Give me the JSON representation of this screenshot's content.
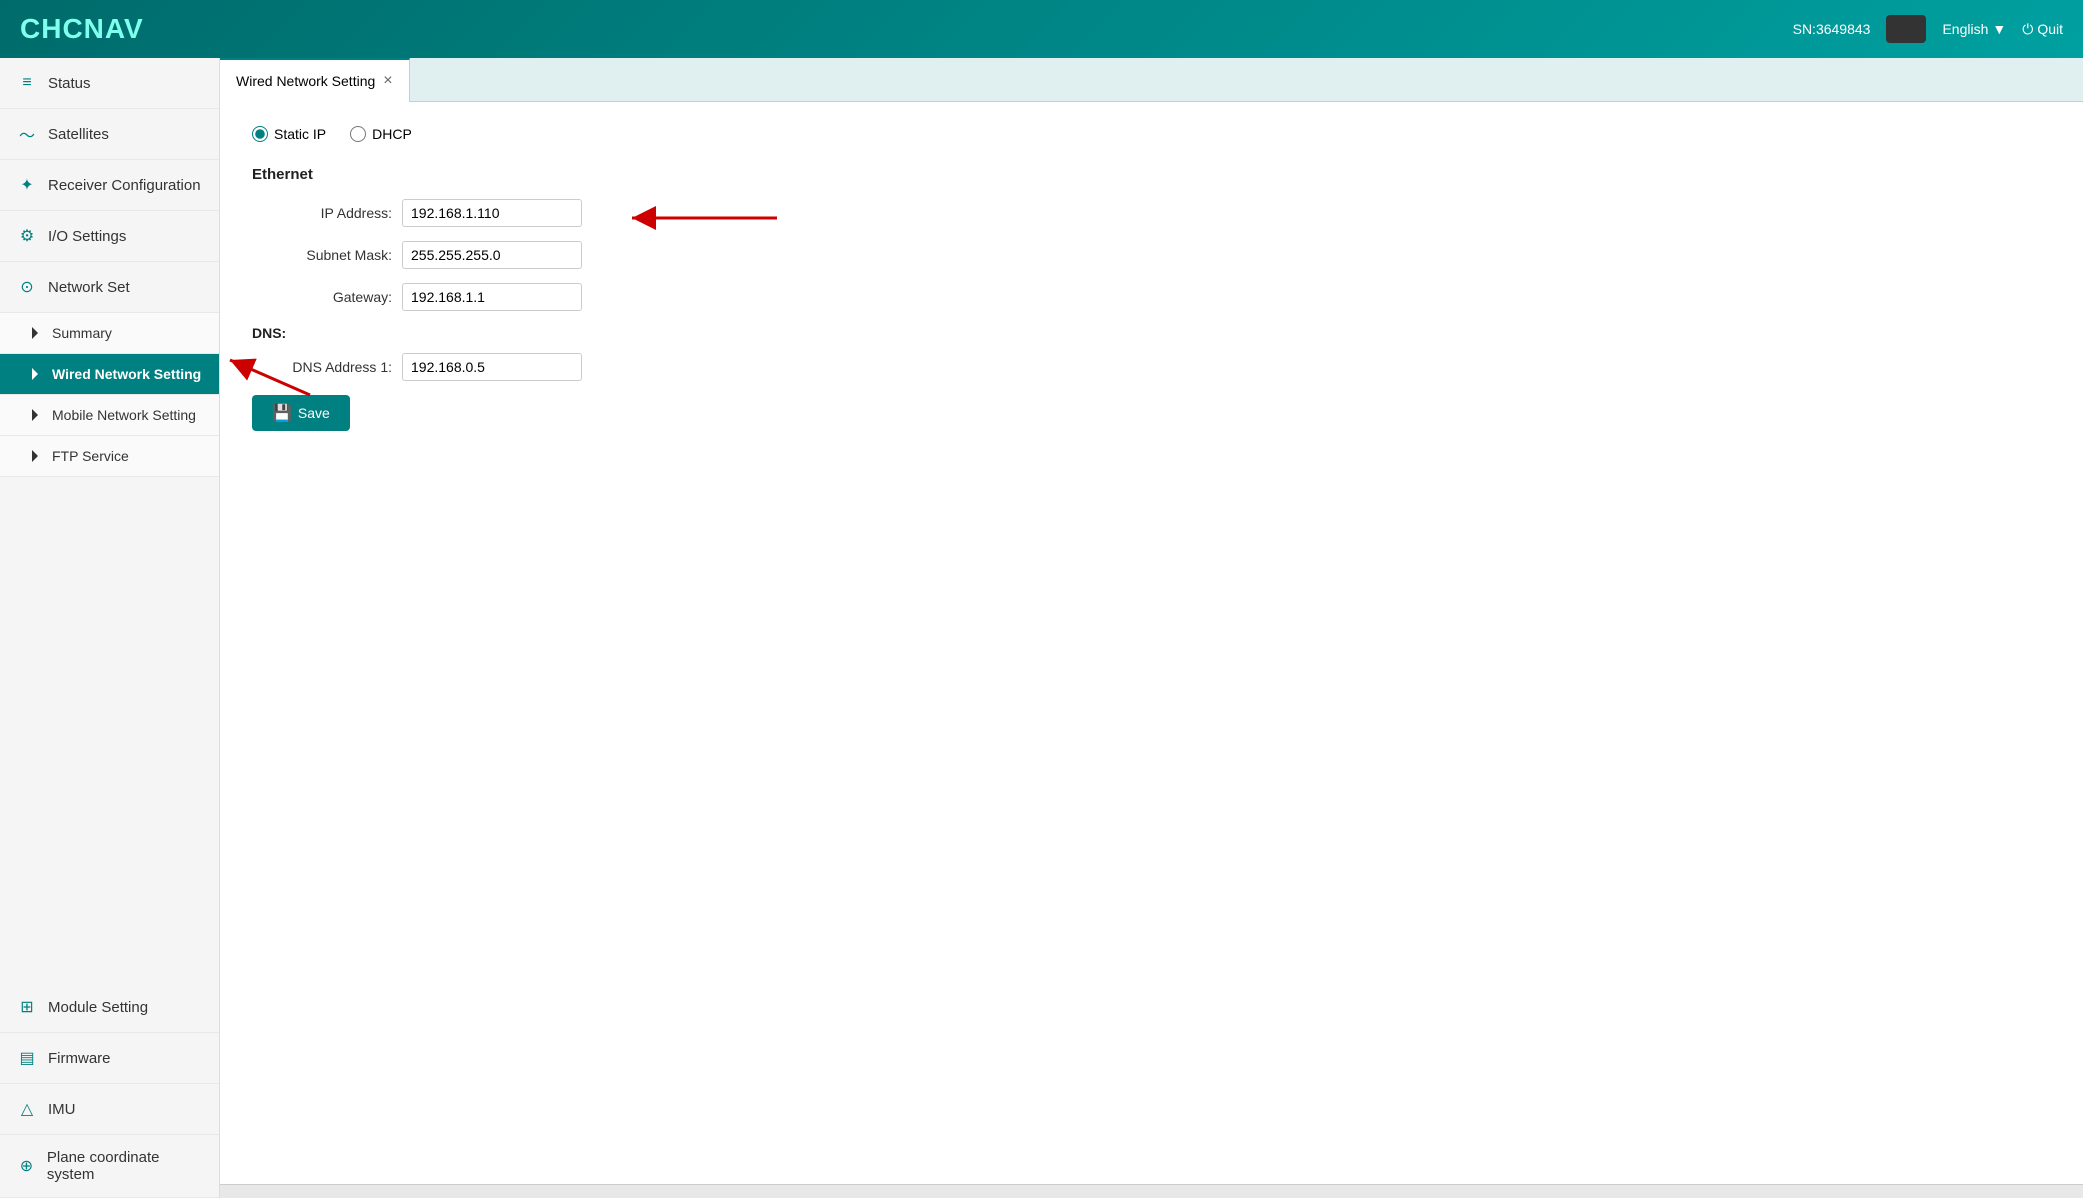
{
  "header": {
    "logo": "CHCNAV",
    "sn_label": "SN:3649843",
    "language": "English",
    "quit_label": "Quit"
  },
  "sidebar": {
    "items": [
      {
        "id": "status",
        "label": "Status",
        "icon": "≡",
        "active": false
      },
      {
        "id": "satellites",
        "label": "Satellites",
        "icon": "~",
        "active": false
      },
      {
        "id": "receiver-config",
        "label": "Receiver Configuration",
        "icon": "✦",
        "active": false
      },
      {
        "id": "io-settings",
        "label": "I/O Settings",
        "icon": "⚙",
        "active": false
      },
      {
        "id": "network-set",
        "label": "Network Set",
        "icon": "⊙",
        "active": true,
        "expanded": true,
        "children": [
          {
            "id": "summary",
            "label": "Summary",
            "active": false
          },
          {
            "id": "wired-network",
            "label": "Wired Network Setting",
            "active": true
          },
          {
            "id": "mobile-network",
            "label": "Mobile Network Setting",
            "active": false
          },
          {
            "id": "ftp-service",
            "label": "FTP Service",
            "active": false
          }
        ]
      },
      {
        "id": "module-setting",
        "label": "Module Setting",
        "icon": "⊞",
        "active": false
      },
      {
        "id": "firmware",
        "label": "Firmware",
        "icon": "▤",
        "active": false
      },
      {
        "id": "imu",
        "label": "IMU",
        "icon": "△",
        "active": false
      },
      {
        "id": "plane-coordinate",
        "label": "Plane coordinate system",
        "icon": "⊕",
        "active": false
      }
    ]
  },
  "tab": {
    "label": "Wired Network Setting",
    "close_icon": "×"
  },
  "form": {
    "radio_options": [
      {
        "id": "static-ip",
        "label": "Static IP",
        "checked": true
      },
      {
        "id": "dhcp",
        "label": "DHCP",
        "checked": false
      }
    ],
    "ethernet_section": "Ethernet",
    "fields": [
      {
        "label": "IP Address:",
        "value": "192.168.1.110",
        "id": "ip-address"
      },
      {
        "label": "Subnet Mask:",
        "value": "255.255.255.0",
        "id": "subnet-mask"
      },
      {
        "label": "Gateway:",
        "value": "192.168.1.1",
        "id": "gateway"
      }
    ],
    "dns_section": "DNS:",
    "dns_fields": [
      {
        "label": "DNS Address 1:",
        "value": "192.168.0.5",
        "id": "dns-address-1"
      }
    ],
    "save_button": "Save"
  }
}
